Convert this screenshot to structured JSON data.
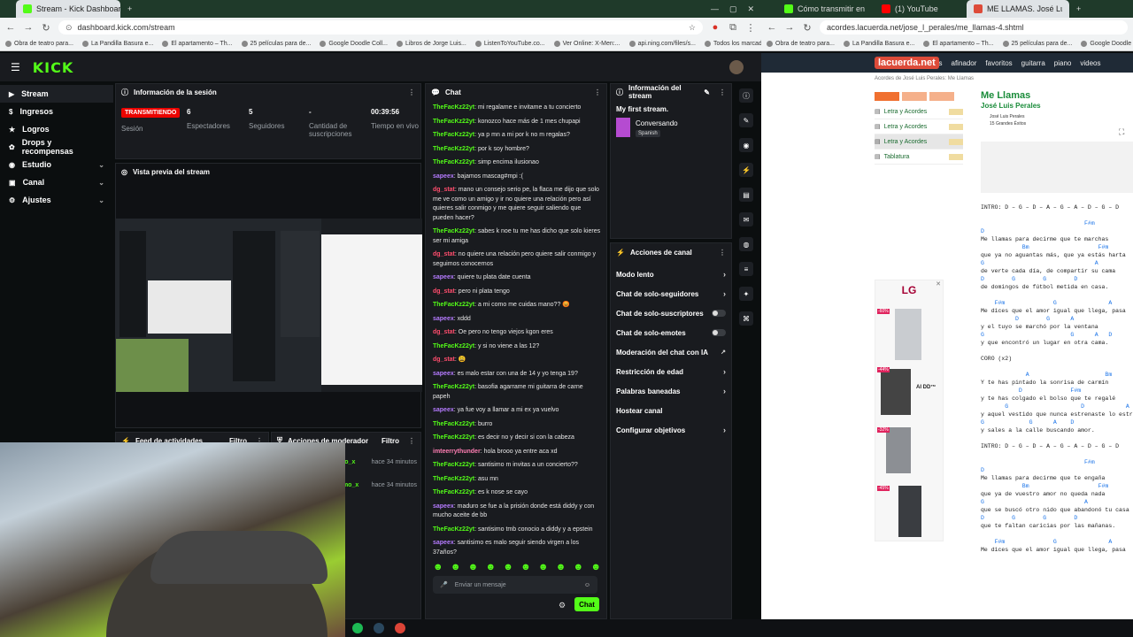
{
  "browser_left": {
    "tabs": [
      {
        "label": "Stream - Kick Dashboard",
        "active": true
      }
    ],
    "url": "dashboard.kick.com/stream",
    "bookmarks": [
      "Obra de teatro para...",
      "La Pandilla Basura e...",
      "El apartamento – Th...",
      "25 películas para de...",
      "Google Doodle Coll...",
      "Libros de Jorge Luis...",
      "ListenToYouTube.co...",
      "Ver Online: X-Men:...",
      "api.ning.com/files/s...",
      "Todos los marcadores"
    ]
  },
  "browser_right": {
    "tabs": [
      {
        "label": "Cómo transmitir en Kick: la gu...",
        "active": false
      },
      {
        "label": "(1) YouTube",
        "active": false
      },
      {
        "label": "ME LLAMAS. José Luis Perales",
        "active": true
      }
    ],
    "url": "acordes.lacuerda.net/jose_l_perales/me_llamas-4.shtml",
    "bookmarks": [
      "Obra de teatro para...",
      "La Pandilla Basura e...",
      "El apartamento – Th...",
      "25 películas para de...",
      "Google Doodle Coll..."
    ]
  },
  "kick": {
    "logo": "KICK",
    "sidebar": [
      {
        "label": "Stream",
        "icon": "video-icon",
        "active": true,
        "chev": false
      },
      {
        "label": "Ingresos",
        "icon": "wallet-icon",
        "active": false,
        "chev": false
      },
      {
        "label": "Logros",
        "icon": "trophy-icon",
        "active": false,
        "chev": false
      },
      {
        "label": "Drops y recompensas",
        "icon": "gift-icon",
        "active": false,
        "chev": false
      },
      {
        "label": "Estudio",
        "icon": "studio-icon",
        "active": false,
        "chev": true
      },
      {
        "label": "Canal",
        "icon": "channel-icon",
        "active": false,
        "chev": true
      },
      {
        "label": "Ajustes",
        "icon": "gear-icon",
        "active": false,
        "chev": true
      }
    ],
    "session": {
      "title": "Información de la sesión",
      "status": "TRANSMITIENDO",
      "session_label": "Sesión",
      "viewers": "6",
      "viewers_label": "Espectadores",
      "followers": "5",
      "followers_label": "Seguidores",
      "subs": "-",
      "subs_label": "Cantidad de suscripciones",
      "time": "00:39:56",
      "time_label": "Tiempo en vivo"
    },
    "preview_title": "Vista previa del stream",
    "activity": {
      "title": "Feed de actividades",
      "filter": "Filtro"
    },
    "mod": {
      "title": "Acciones de moderador",
      "filter": "Filtro",
      "rows": [
        {
          "user": "no_x",
          "time": "hace 34 minutos"
        },
        {
          "user": "imo_x",
          "time": "hace 34 minutos"
        }
      ]
    },
    "chat": {
      "title": "Chat",
      "messages": [
        {
          "user": "TheFacKz22yt",
          "cls": "u1",
          "text": "mi regalame e invitame a tu concierto"
        },
        {
          "user": "TheFacKz22yt",
          "cls": "u1",
          "text": "konozco hace más de 1 mes chupapi"
        },
        {
          "user": "TheFacKz22yt",
          "cls": "u1",
          "text": "ya p mn a mi por k no m regalas?"
        },
        {
          "user": "TheFacKz22yt",
          "cls": "u1",
          "text": "por k soy hombre?"
        },
        {
          "user": "TheFacKz22yt",
          "cls": "u1",
          "text": "simp encima ilusionao"
        },
        {
          "user": "sapeex",
          "cls": "u2",
          "text": "bajamos mascag#mpi :("
        },
        {
          "user": "dg_stat",
          "cls": "u3",
          "text": "mano un consejo serio pe, la flaca me dijo que solo me ve como un amigo y ir no quiere una relación pero así quieres salir conmigo y me quiere seguir saliendo que pueden hacer?"
        },
        {
          "user": "TheFacKz22yt",
          "cls": "u1",
          "text": "sabes k noe tu me has dicho que solo kieres ser mi amiga"
        },
        {
          "user": "dg_stat",
          "cls": "u3",
          "text": "no quiere una relación pero quiere salir conmigo y seguimos conocernos"
        },
        {
          "user": "sapeex",
          "cls": "u2",
          "text": "quiere tu plata date cuenta"
        },
        {
          "user": "dg_stat",
          "cls": "u3",
          "text": "pero ni plata tengo"
        },
        {
          "user": "TheFacKz22yt",
          "cls": "u1",
          "text": "a mi como me cuidas mano?? 😡"
        },
        {
          "user": "sapeex",
          "cls": "u2",
          "text": "xddd"
        },
        {
          "user": "dg_stat",
          "cls": "u3",
          "text": "Oe pero no tengo viejos kgon eres"
        },
        {
          "user": "TheFacKz22yt",
          "cls": "u1",
          "text": "y si no viene a las 12?"
        },
        {
          "user": "dg_stat",
          "cls": "u3",
          "text": "😩"
        },
        {
          "user": "sapeex",
          "cls": "u2",
          "text": "es malo estar con una de 14 y yo tenga 19?"
        },
        {
          "user": "TheFacKz22yt",
          "cls": "u1",
          "text": "basofia agarrame mi guitarra de carne papeh"
        },
        {
          "user": "sapeex",
          "cls": "u2",
          "text": "ya fue voy a llamar a mi ex ya vuelvo"
        },
        {
          "user": "TheFacKz22yt",
          "cls": "u1",
          "text": "burro"
        },
        {
          "user": "TheFacKz22yt",
          "cls": "u1",
          "text": "es decir no y decir si con la cabeza"
        },
        {
          "user": "imteerrythunder",
          "cls": "u4",
          "text": "hola brooo ya entre aca xd"
        },
        {
          "user": "TheFacKz22yt",
          "cls": "u1",
          "text": "santisimo m invitas a un concierto??"
        },
        {
          "user": "TheFacKz22yt",
          "cls": "u1",
          "text": "asu mn"
        },
        {
          "user": "TheFacKz22yt",
          "cls": "u1",
          "text": "es k nose se cayo"
        },
        {
          "user": "sapeex",
          "cls": "u2",
          "text": "maduro se fue a la prisión donde está diddy y con mucho aceite de bb"
        },
        {
          "user": "TheFacKz22yt",
          "cls": "u1",
          "text": "santisimo tmb conocio a diddy y a epstein"
        },
        {
          "user": "sapeex",
          "cls": "u2",
          "text": "santisimo es malo seguir siendo virgen a los 37años?"
        }
      ],
      "input_placeholder": "Enviar un mensaje",
      "send_label": "Chat"
    },
    "stream_info": {
      "title": "Información del stream",
      "stream_title": "My first stream.",
      "category": "Conversando",
      "language": "Spanish"
    },
    "channel_actions": {
      "title": "Acciones de canal",
      "items": [
        {
          "label": "Modo lento",
          "type": "chev"
        },
        {
          "label": "Chat de solo-seguidores",
          "type": "chev"
        },
        {
          "label": "Chat de solo-suscriptores",
          "type": "toggle"
        },
        {
          "label": "Chat de solo-emotes",
          "type": "toggle"
        },
        {
          "label": "Moderación del chat con IA",
          "type": "ext"
        },
        {
          "label": "Restricción de edad",
          "type": "chev"
        },
        {
          "label": "Palabras baneadas",
          "type": "chev"
        },
        {
          "label": "Hostear canal",
          "type": "none"
        },
        {
          "label": "Configurar objetivos",
          "type": "chev"
        }
      ]
    }
  },
  "lacuerda": {
    "brand": "lacuerda.net",
    "nav": [
      "canciones",
      "acordes",
      "afinador",
      "favoritos",
      "guitarra",
      "piano",
      "videos"
    ],
    "breadcrumb": "Acordes de José Luis Perales: Me Llamas",
    "versions": [
      "Letra y Acordes",
      "Letra y Acordes",
      "Letra y Acordes",
      "Tablatura"
    ],
    "song_title": "Me Llamas",
    "artist": "José Luis Perales",
    "meta1": "José Luis Perales",
    "meta2": "15 Grandes Éxitos",
    "ad_brand": "LG",
    "ad_badges": [
      "-60%",
      "-44%",
      "-32%",
      "-45%"
    ],
    "ad_tag": "AI DD™",
    "lyrics": [
      {
        "t": "INTRO: D – G – D – A – G – A – D – G – D",
        "c": false
      },
      {
        "t": "",
        "c": false
      },
      {
        "t": "                              F#m",
        "c": true
      },
      {
        "t": "D",
        "c": true
      },
      {
        "t": "Me llamas para decirme que te marchas",
        "c": false
      },
      {
        "t": "            Bm                    F#m",
        "c": true
      },
      {
        "t": "que ya no aguantas más, que ya estás harta",
        "c": false
      },
      {
        "t": "G                                A",
        "c": true
      },
      {
        "t": "de verte cada día, de compartir su cama",
        "c": false
      },
      {
        "t": "D        G        G        D",
        "c": true
      },
      {
        "t": "de domingos de fútbol metida en casa.",
        "c": false
      },
      {
        "t": "",
        "c": false
      },
      {
        "t": "    F#m              G               A",
        "c": true
      },
      {
        "t": "Me dices que el amor igual que llega, pasa",
        "c": false
      },
      {
        "t": "          D        G      A",
        "c": true
      },
      {
        "t": "y el tuyo se marchó por la ventana",
        "c": false
      },
      {
        "t": "G                         G      A   D",
        "c": true
      },
      {
        "t": "y que encontró un lugar en otra cama.",
        "c": false
      },
      {
        "t": "",
        "c": false
      },
      {
        "t": "CORO (x2)",
        "c": false
      },
      {
        "t": "",
        "c": false
      },
      {
        "t": "             A                      Bm",
        "c": true
      },
      {
        "t": "Y te has pintado la sonrisa de carmín",
        "c": false
      },
      {
        "t": "           D              F#m",
        "c": true
      },
      {
        "t": "y te has colgado el bolso que te regalé",
        "c": false
      },
      {
        "t": "       G                     D            A",
        "c": true
      },
      {
        "t": "y aquel vestido que nunca estrenaste lo estrenas",
        "c": false
      },
      {
        "t": "G             G      A    D",
        "c": true
      },
      {
        "t": "y sales a la calle buscando amor.",
        "c": false
      },
      {
        "t": "",
        "c": false
      },
      {
        "t": "INTRO: D – G – D – A – G – A – D – G – D",
        "c": false
      },
      {
        "t": "",
        "c": false
      },
      {
        "t": "                              F#m",
        "c": true
      },
      {
        "t": "D",
        "c": true
      },
      {
        "t": "Me llamas para decirme que te engaña",
        "c": false
      },
      {
        "t": "            Bm                    F#m",
        "c": true
      },
      {
        "t": "que ya de vuestro amor no queda nada",
        "c": false
      },
      {
        "t": "G                             A",
        "c": true
      },
      {
        "t": "que se buscó otro nido que abandonó tu casa",
        "c": false
      },
      {
        "t": "D        G        G        D",
        "c": true
      },
      {
        "t": "que te faltan caricias por las mañanas.",
        "c": false
      },
      {
        "t": "",
        "c": false
      },
      {
        "t": "    F#m              G               A",
        "c": true
      },
      {
        "t": "Me dices que el amor igual que llega, pasa",
        "c": false
      }
    ]
  }
}
